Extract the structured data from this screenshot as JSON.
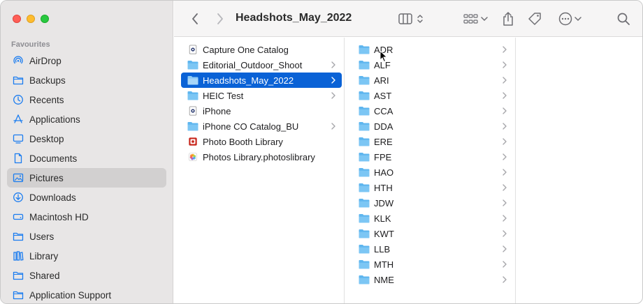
{
  "window": {
    "title": "Headshots_May_2022"
  },
  "sidebar": {
    "section": "Favourites",
    "items": [
      {
        "label": "AirDrop",
        "icon": "airdrop-icon"
      },
      {
        "label": "Backups",
        "icon": "folder-icon"
      },
      {
        "label": "Recents",
        "icon": "clock-icon"
      },
      {
        "label": "Applications",
        "icon": "applications-icon"
      },
      {
        "label": "Desktop",
        "icon": "desktop-icon"
      },
      {
        "label": "Documents",
        "icon": "document-icon"
      },
      {
        "label": "Pictures",
        "icon": "pictures-icon",
        "selected": true
      },
      {
        "label": "Downloads",
        "icon": "download-icon"
      },
      {
        "label": "Macintosh HD",
        "icon": "disk-icon"
      },
      {
        "label": "Users",
        "icon": "folder-icon"
      },
      {
        "label": "Library",
        "icon": "library-icon"
      },
      {
        "label": "Shared",
        "icon": "folder-icon"
      },
      {
        "label": "Application Support",
        "icon": "folder-icon"
      }
    ]
  },
  "column1": {
    "items": [
      {
        "label": "Capture One Catalog",
        "icon": "catalog-icon",
        "chevron": false
      },
      {
        "label": "Editorial_Outdoor_Shoot",
        "icon": "folder-icon",
        "chevron": true
      },
      {
        "label": "Headshots_May_2022",
        "icon": "folder-icon",
        "chevron": true,
        "selected": true
      },
      {
        "label": "HEIC Test",
        "icon": "folder-icon",
        "chevron": true
      },
      {
        "label": "iPhone",
        "icon": "catalog-icon",
        "chevron": false
      },
      {
        "label": "iPhone CO Catalog_BU",
        "icon": "folder-icon",
        "chevron": true
      },
      {
        "label": "Photo Booth Library",
        "icon": "photobooth-icon",
        "chevron": false
      },
      {
        "label": "Photos Library.photoslibrary",
        "icon": "photos-icon",
        "chevron": false
      }
    ]
  },
  "column2": {
    "items": [
      {
        "label": "ADR"
      },
      {
        "label": "ALF"
      },
      {
        "label": "ARI"
      },
      {
        "label": "AST"
      },
      {
        "label": "CCA"
      },
      {
        "label": "DDA"
      },
      {
        "label": "ERE"
      },
      {
        "label": "FPE"
      },
      {
        "label": "HAO"
      },
      {
        "label": "HTH"
      },
      {
        "label": "JDW"
      },
      {
        "label": "KLK"
      },
      {
        "label": "KWT"
      },
      {
        "label": "LLB"
      },
      {
        "label": "MTH"
      },
      {
        "label": "NME"
      }
    ]
  },
  "colors": {
    "selection": "#0a62d6",
    "folder": "#58b3ee",
    "accent_icon": "#1a7cf0"
  }
}
